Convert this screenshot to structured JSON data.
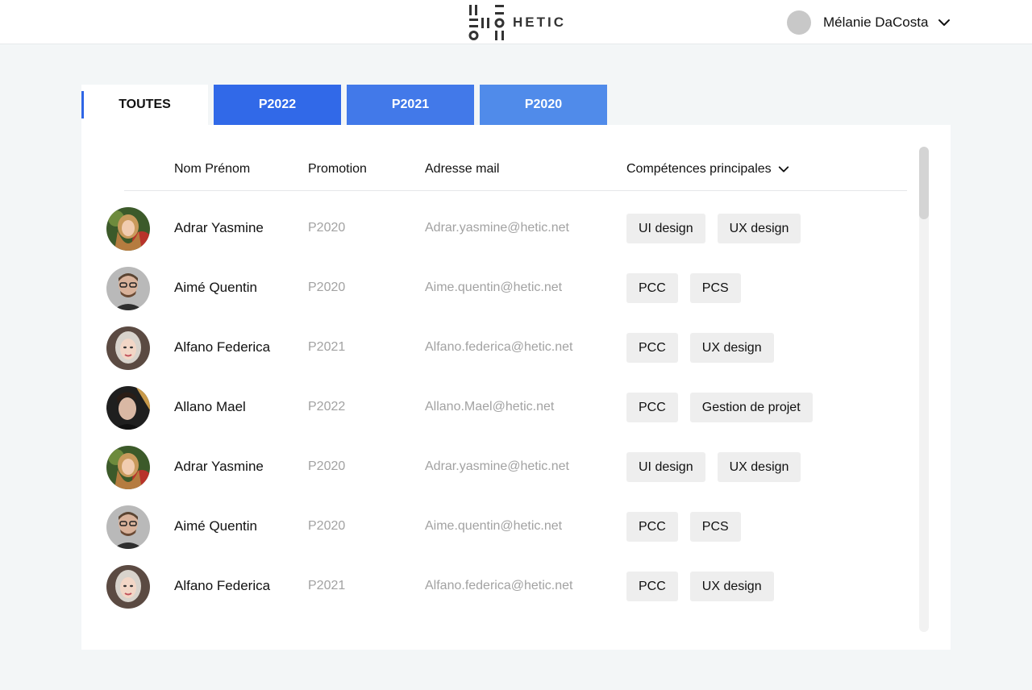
{
  "header": {
    "brand": "HETIC",
    "user_name": "Mélanie DaCosta"
  },
  "tabs": [
    {
      "label": "TOUTES",
      "active": true
    },
    {
      "label": "P2022",
      "active": false,
      "color": "#3169e8"
    },
    {
      "label": "P2021",
      "active": false,
      "color": "#4279e9"
    },
    {
      "label": "P2020",
      "active": false,
      "color": "#508bea"
    }
  ],
  "table": {
    "columns": {
      "name": "Nom Prénom",
      "promotion": "Promotion",
      "email": "Adresse mail",
      "skills": "Compétences principales"
    },
    "rows": [
      {
        "name": "Adrar Yasmine",
        "promotion": "P2020",
        "email": "Adrar.yasmine@hetic.net",
        "skills": [
          "UI design",
          "UX design"
        ]
      },
      {
        "name": "Aimé Quentin",
        "promotion": "P2020",
        "email": "Aime.quentin@hetic.net",
        "skills": [
          "PCC",
          "PCS"
        ]
      },
      {
        "name": "Alfano Federica",
        "promotion": "P2021",
        "email": "Alfano.federica@hetic.net",
        "skills": [
          "PCC",
          "UX design"
        ]
      },
      {
        "name": "Allano Mael",
        "promotion": "P2022",
        "email": "Allano.Mael@hetic.net",
        "skills": [
          "PCC",
          "Gestion de projet"
        ]
      },
      {
        "name": "Adrar Yasmine",
        "promotion": "P2020",
        "email": "Adrar.yasmine@hetic.net",
        "skills": [
          "UI design",
          "UX design"
        ]
      },
      {
        "name": "Aimé Quentin",
        "promotion": "P2020",
        "email": "Aime.quentin@hetic.net",
        "skills": [
          "PCC",
          "PCS"
        ]
      },
      {
        "name": "Alfano Federica",
        "promotion": "P2021",
        "email": "Alfano.federica@hetic.net",
        "skills": [
          "PCC",
          "UX design"
        ]
      }
    ]
  },
  "colors": {
    "accent": "#2f66e6",
    "muted_text": "#a2a2a2",
    "chip_bg": "#eeeeee",
    "page_bg": "#f3f6f7"
  }
}
